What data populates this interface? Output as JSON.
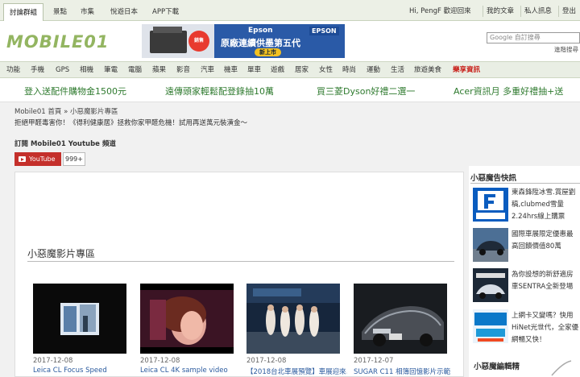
{
  "topbar": {
    "tabs": [
      "討論群組",
      "景點",
      "市集",
      "悅遊日本",
      "APP下載"
    ],
    "user_links": [
      "Hi, PengF 歡迎回來",
      "我的文章",
      "私人訊息",
      "登出"
    ]
  },
  "header": {
    "logo_text": "MOBILE01",
    "ad": {
      "brand": "Epson",
      "logo": "EPSON",
      "slogan": "原廠連續供墨第五代",
      "cta": "新上市",
      "badge": "銷售No.1"
    },
    "search_placeholder": "Google 自訂搜尋",
    "advanced_search": "進階搜尋"
  },
  "nav": {
    "items": [
      "功能",
      "手機",
      "GPS",
      "相機",
      "筆電",
      "電腦",
      "蘋果",
      "影音",
      "汽車",
      "機車",
      "單車",
      "遊戲",
      "居家",
      "女性",
      "時尚",
      "運動",
      "生活",
      "旅遊美食",
      "樂享資訊"
    ]
  },
  "promos": [
    "登入送配件購物金1500元",
    "遠傳頭家輕鬆配登錄抽10萬",
    "買三菱Dyson好禮二選一",
    "Acer資訊月 多重好禮抽+送"
  ],
  "breadcrumb": "Mobile01 首頁 » 小惡魔影片專區",
  "notice": "拒絕甲醛毒害你！《得利健康居》拯救你家甲醛危機！試用再送萬元裝潢金～",
  "subscribe": {
    "heading": "訂閱 Mobile01 Youtube 頻道",
    "button": "YouTube",
    "count": "999+"
  },
  "section_title": "小惡魔影片專區",
  "videos": [
    {
      "date": "2017-12-08",
      "title": "Leica CL Focus Speed"
    },
    {
      "date": "2017-12-08",
      "title": "Leica CL 4K sample video"
    },
    {
      "date": "2017-12-08",
      "title": "【2018台北車展預覽】車展迎來以來..."
    },
    {
      "date": "2017-12-07",
      "title": "SUGAR C11 相簿回憶影片示範"
    }
  ],
  "sidebar": {
    "heading": "小惡魔告快訊",
    "items": [
      {
        "text": "東森鋒陞冰雪.賞屋劉稿,clubmed雪量2.24hrs線上購票",
        "icon": "travel-logo-icon"
      },
      {
        "text": "國際車展限定優惠最高回饋價值80萬",
        "icon": "car-photo"
      },
      {
        "text": "為你設想的新舒適房車SENTRA全新登場",
        "icon": "sentra-photo"
      },
      {
        "text": "上網卡又變嗎？快用HiNet光世代，全家優網暢又快！",
        "icon": "hinet-logo"
      }
    ],
    "heading2": "小惡魔編輯精"
  },
  "colors": {
    "accent_green": "#5a7e34",
    "promo_green": "#2e7a2e",
    "youtube_red": "#c4302b",
    "link_blue": "#2a5a9e"
  }
}
